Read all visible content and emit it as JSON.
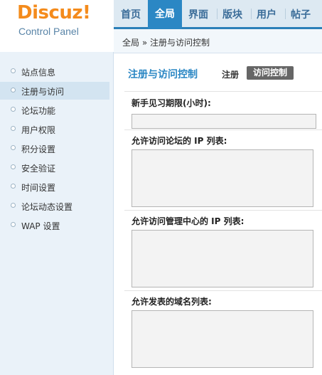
{
  "logo": {
    "title": "Discuz!",
    "subtitle": "Control Panel"
  },
  "nav": {
    "items": [
      "首页",
      "全局",
      "界面",
      "版块",
      "用户",
      "帖子"
    ],
    "active": "全局"
  },
  "breadcrumb": "全局 » 注册与访问控制",
  "sidebar": {
    "items": [
      "站点信息",
      "注册与访问",
      "论坛功能",
      "用户权限",
      "积分设置",
      "安全验证",
      "时间设置",
      "论坛动态设置",
      "WAP 设置"
    ],
    "active_index": 1
  },
  "main": {
    "title": "注册与访问控制",
    "tabs": [
      {
        "label": "注册",
        "active": false
      },
      {
        "label": "访问控制",
        "active": true
      }
    ],
    "fields": [
      {
        "label": "新手见习期限(小时):",
        "type": "text",
        "value": ""
      },
      {
        "label": "允许访问论坛的 IP 列表:",
        "type": "textarea",
        "value": ""
      },
      {
        "label": "允许访问管理中心的 IP 列表:",
        "type": "textarea",
        "value": ""
      },
      {
        "label": "允许发表的域名列表:",
        "type": "textarea",
        "value": ""
      }
    ]
  },
  "colors": {
    "accent": "#2b87c4",
    "logo": "#f48b1c",
    "sidebar_bg": "#eaf2f9"
  }
}
